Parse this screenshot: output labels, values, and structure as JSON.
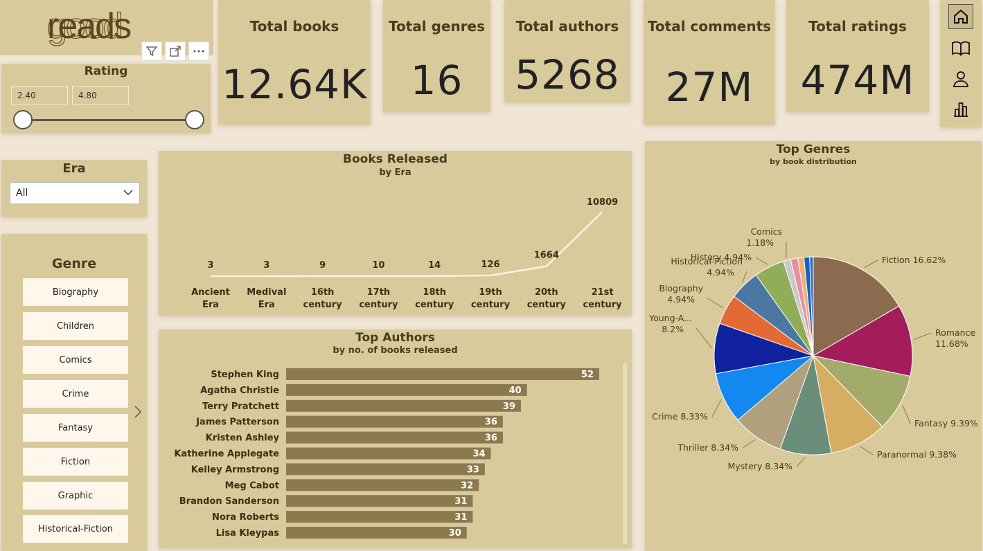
{
  "logo": {
    "light": "good",
    "dark": "reads"
  },
  "toolbar": {
    "filter_icon": "filter-icon",
    "focus_icon": "focus-mode-icon",
    "more_icon": "more-options-icon"
  },
  "kpis": [
    {
      "title": "Total books",
      "value": "12.64K"
    },
    {
      "title": "Total genres",
      "value": "16"
    },
    {
      "title": "Total authors",
      "value": "5268"
    },
    {
      "title": "Total comments",
      "value": "27M"
    },
    {
      "title": "Total ratings",
      "value": "474M"
    }
  ],
  "rating": {
    "title": "Rating",
    "min": "2.40",
    "max": "4.80",
    "min_fraction": 0,
    "max_fraction": 1
  },
  "era": {
    "title": "Era",
    "selected": "All"
  },
  "genre": {
    "title": "Genre",
    "items": [
      "Biography",
      "Children",
      "Comics",
      "Crime",
      "Fantasy",
      "Fiction",
      "Graphic",
      "Historical-Fiction"
    ]
  },
  "nav": [
    "home-icon",
    "book-icon",
    "person-icon",
    "bar-chart-icon"
  ],
  "chart_data": [
    {
      "type": "line",
      "title": "Books Released",
      "subtitle": "by Era",
      "categories": [
        [
          "Ancient",
          "Era"
        ],
        [
          "Medival",
          "Era"
        ],
        [
          "16th",
          "century"
        ],
        [
          "17th",
          "century"
        ],
        [
          "18th",
          "century"
        ],
        [
          "19th",
          "century"
        ],
        [
          "20th",
          "century"
        ],
        [
          "21st",
          "century"
        ]
      ],
      "values": [
        3,
        3,
        9,
        10,
        14,
        126,
        1664,
        10809
      ],
      "line_color": "#fbf3e0"
    },
    {
      "type": "bar",
      "orientation": "horizontal",
      "title": "Top Authors",
      "subtitle": "by no. of books released",
      "categories": [
        "Stephen King",
        "Agatha Christie",
        "Terry Pratchett",
        "James Patterson",
        "Kristen Ashley",
        "Katherine Applegate",
        "Kelley Armstrong",
        "Meg Cabot",
        "Brandon Sanderson",
        "Nora Roberts",
        "Lisa Kleypas"
      ],
      "values": [
        52,
        40,
        39,
        36,
        36,
        34,
        33,
        32,
        31,
        31,
        30
      ],
      "bar_color": "#8b7a4d"
    },
    {
      "type": "pie",
      "title": "Top Genres",
      "subtitle": "by book distribution",
      "slices": [
        {
          "label": "Fiction 16.62%",
          "value": 16.62,
          "color": "#8c6a50"
        },
        {
          "label": "Romance 11.68%",
          "value": 11.68,
          "color": "#a51c5b"
        },
        {
          "label": "Fantasy 9.39%",
          "value": 9.39,
          "color": "#a3ab6b"
        },
        {
          "label": "Paranormal 9.38%",
          "value": 9.38,
          "color": "#d6ae62"
        },
        {
          "label": "Mystery 8.34%",
          "value": 8.34,
          "color": "#6b8e7b"
        },
        {
          "label": "Thriller 8.34%",
          "value": 8.34,
          "color": "#b0a07d"
        },
        {
          "label": "Crime 8.33%",
          "value": 8.33,
          "color": "#1288f0"
        },
        {
          "label": "Young-A... 8.2%",
          "value": 8.2,
          "color": "#11229e"
        },
        {
          "label": "Biography 4.94%",
          "value": 4.94,
          "color": "#e36a34"
        },
        {
          "label": "Historical-Fiction 4.94%",
          "value": 4.94,
          "color": "#4a78a3"
        },
        {
          "label": "History 4.94%",
          "value": 4.94,
          "color": "#92ad58"
        },
        {
          "label": "Comics 1.18%",
          "value": 1.18,
          "color": "#c9c9c9"
        },
        {
          "label": "",
          "value": 1.18,
          "color": "#e88fa0"
        },
        {
          "label": "",
          "value": 1.0,
          "color": "#f0b07a"
        },
        {
          "label": "",
          "value": 0.9,
          "color": "#1560c0"
        },
        {
          "label": "",
          "value": 0.6,
          "color": "#3a6fbf"
        }
      ]
    }
  ]
}
